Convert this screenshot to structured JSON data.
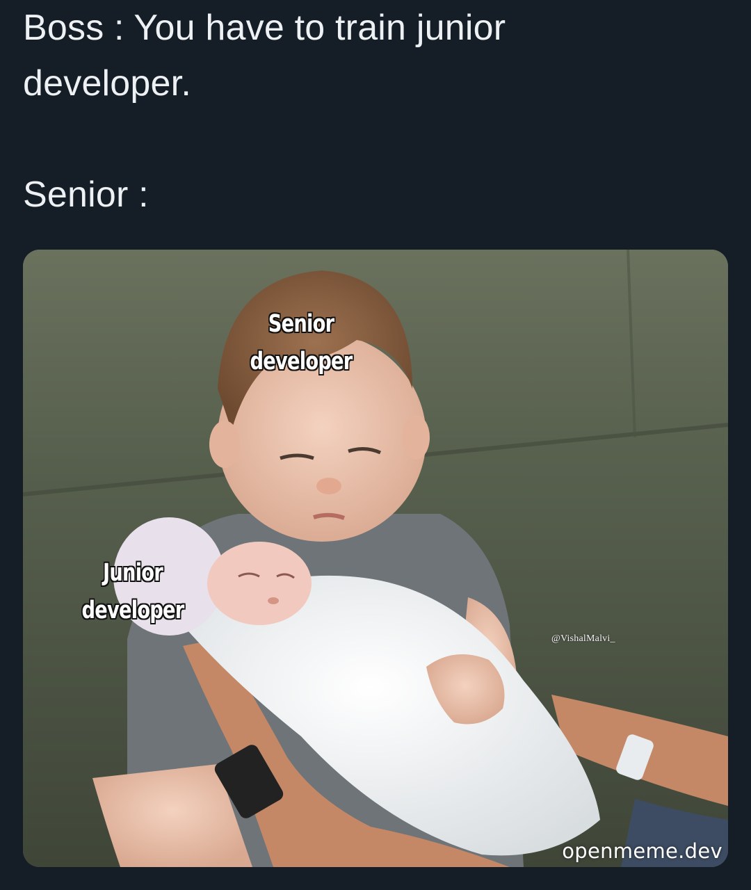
{
  "tweet": {
    "line_1": "Boss : You have to train junior",
    "line_2": "developer.",
    "line_3": "Senior :"
  },
  "meme": {
    "label_top_line_1": "Senior",
    "label_top_line_2": "developer",
    "label_left_line_1": "Junior",
    "label_left_line_2": "developer",
    "credit": "@VishalMalvi_",
    "watermark": "openmeme.dev"
  },
  "colors": {
    "background": "#151d27",
    "text": "#eef1f4",
    "couch": "#5d6553"
  }
}
